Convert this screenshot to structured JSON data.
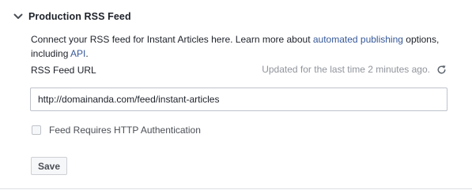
{
  "section": {
    "title": "Production RSS Feed",
    "expanded": true,
    "toggle_icon": "chevron-down-icon"
  },
  "description": {
    "text_before": "Connect your RSS feed for Instant Articles here. Learn more about ",
    "link_automated_publishing": "automated publishing",
    "text_middle": " options, including ",
    "link_api": "API",
    "text_after": "."
  },
  "feed": {
    "label": "RSS Feed URL",
    "updated_status": "Updated for the last time 2 minutes ago.",
    "refresh_icon": "refresh-icon",
    "url_value": "http://domainanda.com/feed/instant-articles"
  },
  "auth": {
    "label": "Feed Requires HTTP Authentication",
    "checked": false
  },
  "actions": {
    "save_label": "Save"
  },
  "colors": {
    "text": "#1d2129",
    "link": "#365899",
    "muted": "#90949c",
    "border": "#bdc1c9"
  }
}
